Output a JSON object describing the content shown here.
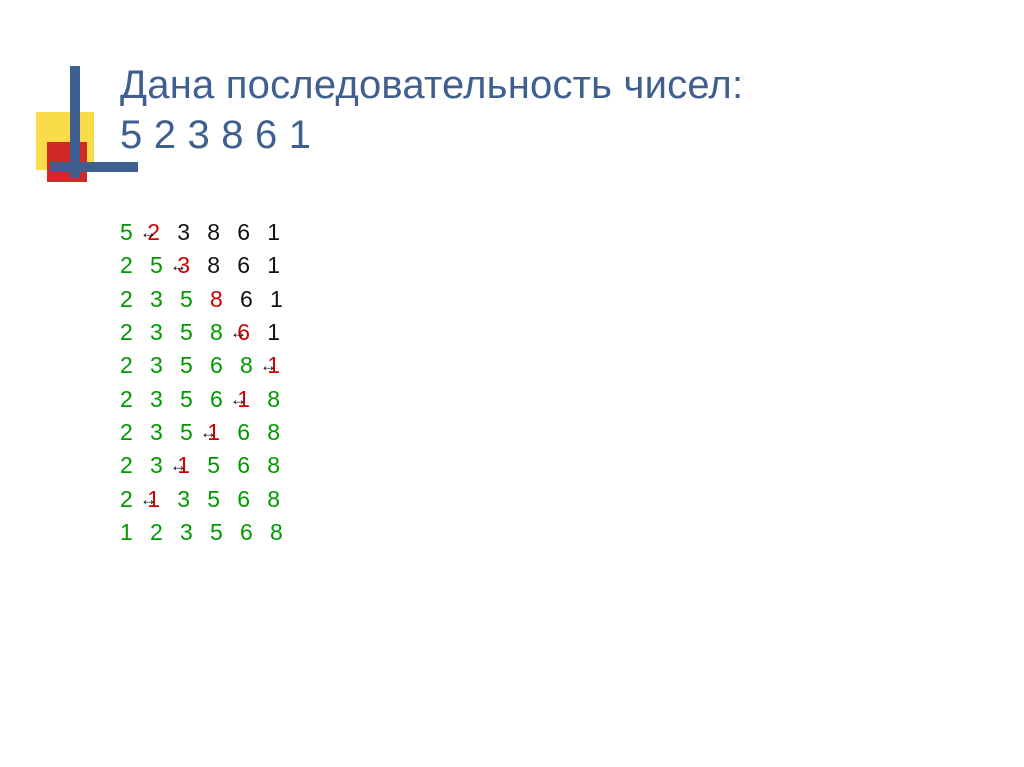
{
  "title": {
    "line1": "Дана последовательность чисел:",
    "line2": "5  2  3  8  6  1"
  },
  "rows": [
    {
      "cells": [
        {
          "v": "5",
          "c": "green"
        },
        {
          "a": true
        },
        {
          "v": "2",
          "c": "red"
        },
        {
          "v": "3",
          "c": "black"
        },
        {
          "v": "8",
          "c": "black"
        },
        {
          "v": "6",
          "c": "black"
        },
        {
          "v": "1",
          "c": "black"
        }
      ]
    },
    {
      "cells": [
        {
          "v": "2",
          "c": "green"
        },
        {
          "v": "5",
          "c": "green"
        },
        {
          "a": true
        },
        {
          "v": "3",
          "c": "red"
        },
        {
          "v": "8",
          "c": "black"
        },
        {
          "v": "6",
          "c": "black"
        },
        {
          "v": "1",
          "c": "black"
        }
      ]
    },
    {
      "cells": [
        {
          "v": "2",
          "c": "green"
        },
        {
          "v": "3",
          "c": "green"
        },
        {
          "v": "5",
          "c": "green"
        },
        {
          "v": "8",
          "c": "red"
        },
        {
          "v": "6",
          "c": "black"
        },
        {
          "v": "1",
          "c": "black"
        }
      ]
    },
    {
      "cells": [
        {
          "v": "2",
          "c": "green"
        },
        {
          "v": "3",
          "c": "green"
        },
        {
          "v": "5",
          "c": "green"
        },
        {
          "v": "8",
          "c": "green"
        },
        {
          "a": true
        },
        {
          "v": "6",
          "c": "red"
        },
        {
          "v": "1",
          "c": "black"
        }
      ]
    },
    {
      "cells": [
        {
          "v": "2",
          "c": "green"
        },
        {
          "v": "3",
          "c": "green"
        },
        {
          "v": "5",
          "c": "green"
        },
        {
          "v": "6",
          "c": "green"
        },
        {
          "v": "8",
          "c": "green"
        },
        {
          "a": true
        },
        {
          "v": "1",
          "c": "red"
        }
      ]
    },
    {
      "cells": [
        {
          "v": "2",
          "c": "green"
        },
        {
          "v": "3",
          "c": "green"
        },
        {
          "v": "5",
          "c": "green"
        },
        {
          "v": "6",
          "c": "green"
        },
        {
          "a": true
        },
        {
          "v": "1",
          "c": "red"
        },
        {
          "v": "8",
          "c": "green"
        }
      ]
    },
    {
      "cells": [
        {
          "v": "2",
          "c": "green"
        },
        {
          "v": "3",
          "c": "green"
        },
        {
          "v": "5",
          "c": "green"
        },
        {
          "a": true
        },
        {
          "v": "1",
          "c": "red"
        },
        {
          "v": "6",
          "c": "green"
        },
        {
          "v": "8",
          "c": "green"
        }
      ]
    },
    {
      "cells": [
        {
          "v": "2",
          "c": "green"
        },
        {
          "v": "3",
          "c": "green"
        },
        {
          "a": true
        },
        {
          "v": "1",
          "c": "red"
        },
        {
          "v": "5",
          "c": "green"
        },
        {
          "v": "6",
          "c": "green"
        },
        {
          "v": "8",
          "c": "green"
        }
      ]
    },
    {
      "cells": [
        {
          "v": "2",
          "c": "green"
        },
        {
          "a": true
        },
        {
          "v": "1",
          "c": "red"
        },
        {
          "v": "3",
          "c": "green"
        },
        {
          "v": "5",
          "c": "green"
        },
        {
          "v": "6",
          "c": "green"
        },
        {
          "v": "8",
          "c": "green"
        }
      ]
    },
    {
      "cells": [
        {
          "v": "1",
          "c": "green"
        },
        {
          "v": "2",
          "c": "green"
        },
        {
          "v": "3",
          "c": "green"
        },
        {
          "v": "5",
          "c": "green"
        },
        {
          "v": "6",
          "c": "green"
        },
        {
          "v": "8",
          "c": "green"
        }
      ]
    }
  ]
}
